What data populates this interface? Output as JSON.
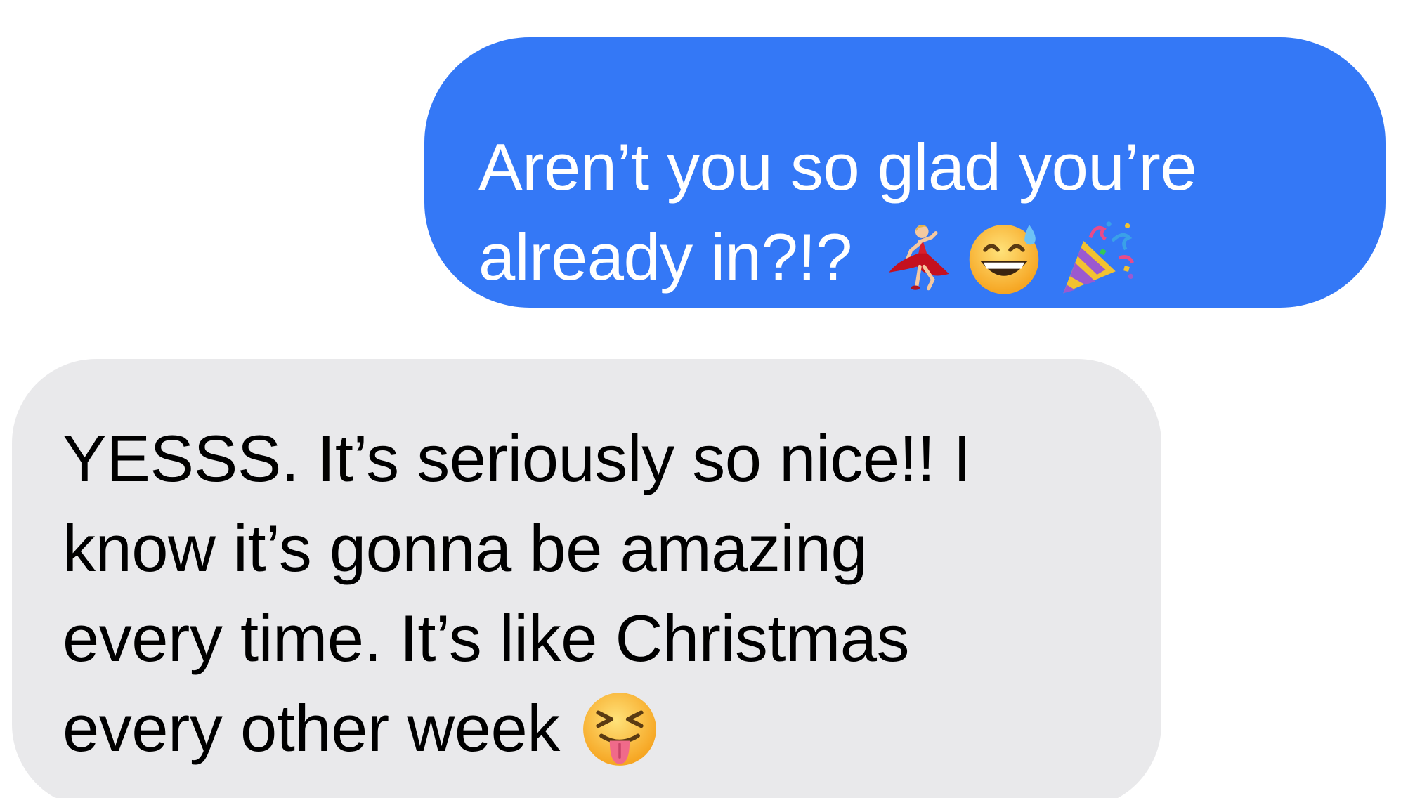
{
  "conversation": {
    "messages": [
      {
        "sender": "me",
        "lines": [
          "Aren’t you so glad you’re",
          "already in?!?"
        ],
        "emojis": [
          "dancer-emoji",
          "grinning-sweat-emoji",
          "party-popper-emoji"
        ]
      },
      {
        "sender": "them",
        "lines": [
          "YESSS. It’s seriously so nice!! I",
          "know it’s gonna be amazing",
          "every time. It’s like Christmas",
          "every other week"
        ],
        "emojis": [
          "squinting-tongue-emoji"
        ]
      }
    ]
  },
  "colors": {
    "sent_bubble": "#3478f6",
    "received_bubble": "#e9e9eb",
    "sent_text": "#ffffff",
    "received_text": "#000000"
  }
}
